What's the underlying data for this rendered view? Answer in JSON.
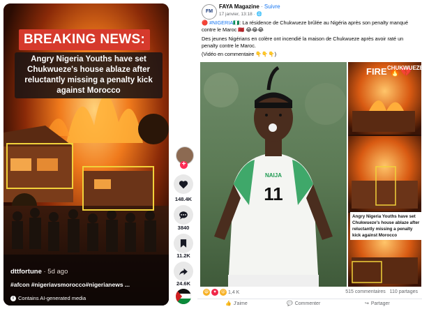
{
  "video": {
    "breaking_label": "BREAKING NEWS:",
    "headline": "Angry Nigeria Youths have set Chukwueze's house ablaze after reluctantly missing a penalty kick against Morocco",
    "username": "dttfortune",
    "age": " · 5d ago",
    "hashtags": "#afcon #nigeriavsmorocco#nigerianews ...",
    "ai_notice": "Contains AI-generated media"
  },
  "rail": {
    "likes": "148.4K",
    "comments": "3840",
    "saves": "11.2K",
    "shares": "24.6K"
  },
  "post": {
    "page_name": "FAYA Magazine",
    "separator": " · ",
    "follow_label": "Suivre",
    "timestamp": "17 janvier, 13:18 · ",
    "line1_prefix": "🔴 ",
    "hashtag": "#NIGERIA",
    "line1_rest": "🇳🇬: La résidence de Chukwueze brûlée au Nigéria après son penalty manqué contre le Maroc 🇲🇦 😂😂😂",
    "line2": "Des jeunes Nigérians en colère ont incendié la maison de Chukwueze après avoir raté un penalty contre le Maroc.",
    "line3": "(Vidéo en commentaire 👇👇👇)",
    "side_label": "FIRE",
    "side_label_top": "CHUKWUEZE",
    "side_caption": "Angry Nigeria Youths have set Chukwueze's house ablaze after reluctantly missing a penalty kick against Morocco",
    "shirt_number": "11",
    "shirt_text": "NAIJA",
    "reactions_count": "1,4 K",
    "comments_count": "515 commentaires",
    "shares_count": "110 partages",
    "action_like": "J'aime",
    "action_comment": "Commenter",
    "action_share": "Partager"
  },
  "colors": {
    "breaking_red": "#d63a2c",
    "highlight_yellow": "#f1d23a",
    "fb_blue": "#1877f2",
    "tiktok_pink": "#fe2c55"
  }
}
